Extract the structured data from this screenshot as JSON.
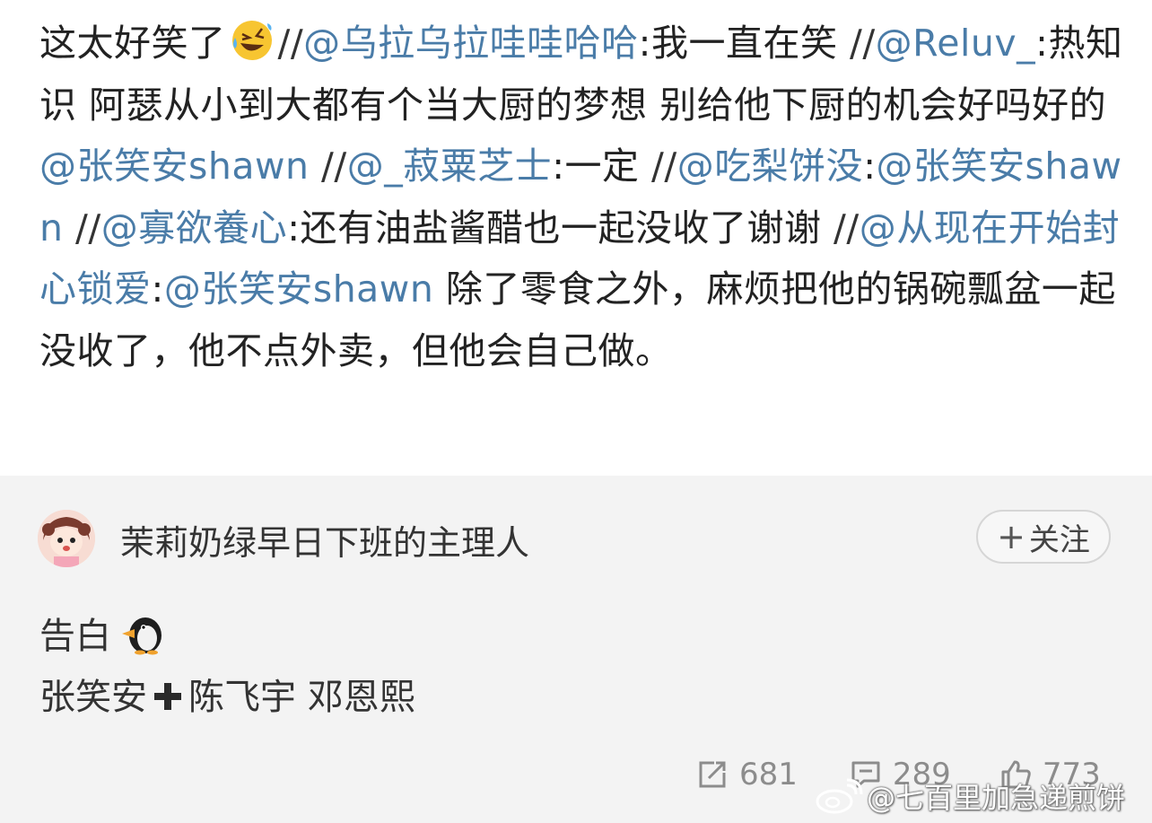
{
  "repost": {
    "segments": [
      {
        "type": "text",
        "text": "这太好笑了"
      },
      {
        "type": "emoji",
        "name": "rolling-on-floor-laughing-emoji"
      },
      {
        "type": "sep",
        "text": "//"
      },
      {
        "type": "mention",
        "text": "@乌拉乌拉哇哇哈哈"
      },
      {
        "type": "text",
        "text": ":我一直在笑 "
      },
      {
        "type": "sep",
        "text": "//"
      },
      {
        "type": "mention",
        "text": "@Reluv_"
      },
      {
        "type": "text",
        "text": ":热知识 阿瑟从小到大都有个当大厨的梦想 别给他下厨的机会好吗好的 "
      },
      {
        "type": "mention",
        "text": "@张笑安shawn"
      },
      {
        "type": "text",
        "text": " "
      },
      {
        "type": "sep",
        "text": "//"
      },
      {
        "type": "mention",
        "text": "@_菽粟芝士"
      },
      {
        "type": "text",
        "text": ":一定 "
      },
      {
        "type": "sep",
        "text": "//"
      },
      {
        "type": "mention",
        "text": "@吃梨饼没"
      },
      {
        "type": "text",
        "text": ":"
      },
      {
        "type": "mention",
        "text": "@张笑安shawn"
      },
      {
        "type": "text",
        "text": " "
      },
      {
        "type": "sep",
        "text": "//"
      },
      {
        "type": "mention",
        "text": "@寡欲養心"
      },
      {
        "type": "text",
        "text": ":还有油盐酱醋也一起没收了谢谢 "
      },
      {
        "type": "sep",
        "text": "//"
      },
      {
        "type": "mention",
        "text": "@从现在开始封心锁爱"
      },
      {
        "type": "text",
        "text": ":"
      },
      {
        "type": "mention",
        "text": "@张笑安shawn"
      },
      {
        "type": "text",
        "text": " 除了零食之外，麻烦把他的锅碗瓢盆一起没收了，他不点外卖，但他会自己做。"
      }
    ]
  },
  "original": {
    "username": "茉莉奶绿早日下班的主理人",
    "follow_label": "关注",
    "line1_text": "告白",
    "line1_emoji": "penguin-emoji",
    "line2_a": "张笑安",
    "line2_icon": "heavy-plus-icon",
    "line2_b": "陈飞宇 邓恩熙"
  },
  "stats": {
    "reposts": "681",
    "comments": "289",
    "likes": "773"
  },
  "watermark": "@七百里加急递煎饼",
  "colors": {
    "mention": "#4a7ca8",
    "original_bg": "#f3f3f3",
    "stat_gray": "#8c8c8c"
  }
}
